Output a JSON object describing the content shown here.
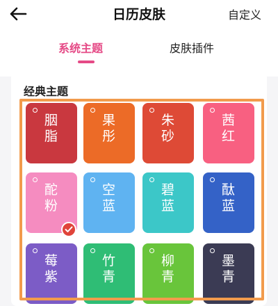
{
  "header": {
    "title": "日历皮肤",
    "custom_label": "自定义",
    "back_icon": "back-arrow-icon"
  },
  "tabs": [
    {
      "label": "系统主题",
      "active": true
    },
    {
      "label": "皮肤插件",
      "active": false
    }
  ],
  "section": {
    "title": "经典主题"
  },
  "themes": [
    {
      "line1": "胭",
      "line2": "脂",
      "color": "#c9383f"
    },
    {
      "line1": "果",
      "line2": "彤",
      "color": "#ec6b27"
    },
    {
      "line1": "朱",
      "line2": "砂",
      "color": "#de4a36"
    },
    {
      "line1": "茜",
      "line2": "红",
      "color": "#f86081"
    },
    {
      "line1": "酡",
      "line2": "粉",
      "color": "#f58cc0",
      "selected": true
    },
    {
      "line1": "空",
      "line2": "蓝",
      "color": "#5fb3f1"
    },
    {
      "line1": "碧",
      "line2": "蓝",
      "color": "#3cc7c8"
    },
    {
      "line1": "酞",
      "line2": "蓝",
      "color": "#3462c7"
    },
    {
      "line1": "莓",
      "line2": "紫",
      "color": "#7c5cc6"
    },
    {
      "line1": "竹",
      "line2": "青",
      "color": "#2fbd75"
    },
    {
      "line1": "柳",
      "line2": "青",
      "color": "#69c53b"
    },
    {
      "line1": "墨",
      "line2": "青",
      "color": "#3b3b54"
    }
  ],
  "selected_icon": "checkmark-icon"
}
